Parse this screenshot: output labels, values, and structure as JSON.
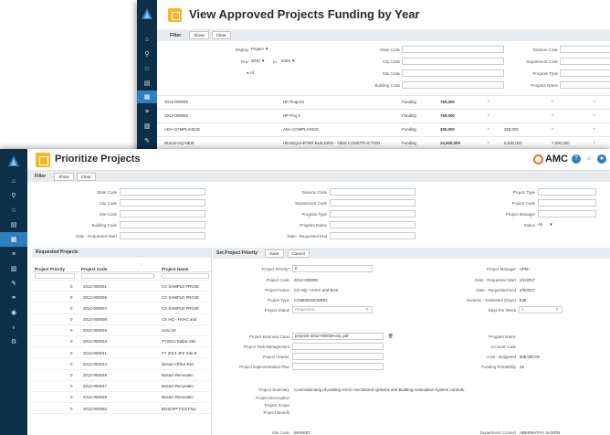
{
  "back": {
    "title": "View Approved Projects Funding by Year",
    "filter_label": "Filter",
    "show_label": "Show",
    "clear_label": "Clear",
    "display_label": "Display",
    "display_value": "Project",
    "year_label": "Year",
    "year_from": "2010",
    "year_to_label": "to",
    "year_to": "2023",
    "all_label": "All",
    "fields": {
      "state_code": "State Code",
      "city_code": "City Code",
      "site_code": "Site Code",
      "building_code": "Building Code",
      "division_code": "Division Code",
      "department_code": "Department Code",
      "program_type": "Program Type",
      "program_name": "Program Name"
    },
    "rows": [
      {
        "code": "2012-000055",
        "name": "HP Project1",
        "type": "Funding",
        "amt": "750,000",
        "c2": "*",
        "c3": "",
        "c4": "*",
        "c5": "*"
      },
      {
        "code": "2012-000056",
        "name": "HP Proj 2",
        "type": "Funding",
        "amt": "750,000",
        "c2": "*",
        "c3": "",
        "c4": "*",
        "c5": "*"
      },
      {
        "code": "ADA COMPLIANCE",
        "name": "ADA COMPLIANCE",
        "type": "Funding",
        "amt": "350,000",
        "c2": "*",
        "c3": "350,000",
        "c4": "*",
        "c5": "*"
      },
      {
        "code": "BUILD-HQ-NEW",
        "name": "HEADQUARTER BUILDING - NEW CONSTRUCTION",
        "type": "Funding",
        "amt": "24,500,000",
        "c2": "*",
        "c3": "5,000,000",
        "c4": "7,000,000",
        "c5": "*"
      }
    ]
  },
  "front": {
    "title": "Prioritize Projects",
    "brand": "AMC",
    "filter_label": "Filter",
    "show_label": "Show",
    "clear_label": "Clear",
    "filter_fields": {
      "state_code": "State Code",
      "city_code": "City Code",
      "site_code": "Site Code",
      "building_code": "Building Code",
      "date_requested_start": "Date - Requested Start",
      "division_code": "Division Code",
      "department_code": "Department Code",
      "program_type": "Program Type",
      "program_name": "Program Name",
      "date_requested_end": "Date - Requested End",
      "project_type": "Project Type",
      "project_code": "Project Code",
      "project_manager": "Project Manager",
      "status": "Status",
      "status_value": "All"
    },
    "requested_projects": {
      "heading": "Requested Projects",
      "col_priority": "Project Priority",
      "col_code": "Project Code",
      "col_name": "Project Name",
      "rows": [
        {
          "priority": "0",
          "code": "2012-000001",
          "name": "CX SAMPLE PROJE"
        },
        {
          "priority": "0",
          "code": "2012-000006",
          "name": "CX SAMPLE PROJE"
        },
        {
          "priority": "0",
          "code": "2012-000007",
          "name": "CX SAMPLE PROJE"
        },
        {
          "priority": "0",
          "code": "2012-000009",
          "name": "CX HQ - HVAC and"
        },
        {
          "priority": "0",
          "code": "2012-000029",
          "name": "Univ SX"
        },
        {
          "priority": "0",
          "code": "2012-000033",
          "name": "FY2014 Dallas Site"
        },
        {
          "priority": "0",
          "code": "2012-000041",
          "name": "FY 2014 JFK Site B"
        },
        {
          "priority": "0",
          "code": "2012-000044",
          "name": "Boston Office Ren"
        },
        {
          "priority": "0",
          "code": "2012-000046",
          "name": "Boston Renovatio"
        },
        {
          "priority": "0",
          "code": "2012-000047",
          "name": "Boston Renovatio"
        },
        {
          "priority": "0",
          "code": "2012-000048",
          "name": "Boston Renovatio"
        },
        {
          "priority": "0",
          "code": "2012-000050",
          "name": "BOSOFF First Floo"
        }
      ]
    },
    "set_priority": {
      "heading": "Set Project Priority",
      "save_label": "Save",
      "cancel_label": "Cancel",
      "project_priority_label": "Project Priority*",
      "project_priority_value": "0",
      "project_code_label": "Project Code",
      "project_code_value": "2012-000006",
      "project_name_label": "Project Name",
      "project_name_value": "CX HQ - HVAC and BAS",
      "project_type_label": "Project Type",
      "project_type_value": "COMMISSIONING",
      "project_status_label": "Project Status",
      "project_status_value": "Requested",
      "project_manager_label": "Project Manager",
      "project_manager_value": "APM",
      "date_req_start_label": "Date - Requested Start",
      "date_req_start_value": "1/1/2017",
      "date_req_end_label": "Date - Requested End",
      "date_req_end_value": "4/9/2017",
      "duration_label": "Duration - Estimated (Days)",
      "duration_value": "848",
      "days_per_week_label": "Days Per Week",
      "days_per_week_value": "5",
      "business_case_label": "Project Business Case",
      "business_case_value": "projects-2012-000009-doc.pdf",
      "risk_mgmt_label": "Project Risk Management",
      "charter_label": "Project Charter",
      "impl_plan_label": "Project Implementation Plan",
      "program_name_label": "Program Name",
      "account_code_label": "Account Code",
      "cost_budgeted_label": "Cost - Budgeted",
      "cost_budgeted_value": "$48,000.00",
      "funding_probability_label": "Funding Probability",
      "funding_probability_value": "25",
      "summary_label": "Project Summary",
      "summary_value": "Commissioning of existing HVAC mechanical systems and Building Automation System controls.",
      "description_label": "Project Description",
      "scope_label": "Project Scope",
      "benefit_label": "Project Benefit",
      "site_code_label": "Site Code",
      "site_code_value": "MARKET",
      "dept_contact_label": "Department Contact",
      "dept_contact_value": "ABERNATHY, ALISON"
    }
  }
}
